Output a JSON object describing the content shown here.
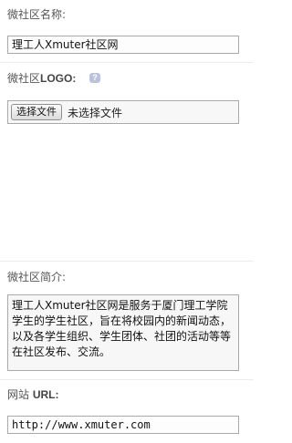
{
  "form": {
    "community_name": {
      "label": "微社区名称:",
      "value": "理工人Xmuter社区网"
    },
    "community_logo": {
      "label_prefix": "微社区",
      "label_latin": "LOGO:",
      "help_icon": "question-icon",
      "help_glyph": "?",
      "file_button_label": "选择文件",
      "file_status": "未选择文件"
    },
    "community_intro": {
      "label": "微社区简介:",
      "value": "理工人Xmuter社区网是服务于厦门理工学院学生的学生社区，旨在将校园内的新闻动态，以及各学生组织、学生团体、社团的活动等等在社区发布、交流。"
    },
    "website_url": {
      "label_prefix": "网站 ",
      "label_latin": "URL:",
      "value": "http://www.xmuter.com"
    }
  },
  "colors": {
    "border": "#a9a9a9",
    "divider": "#ececec",
    "help_icon": "#b9c4dc"
  }
}
